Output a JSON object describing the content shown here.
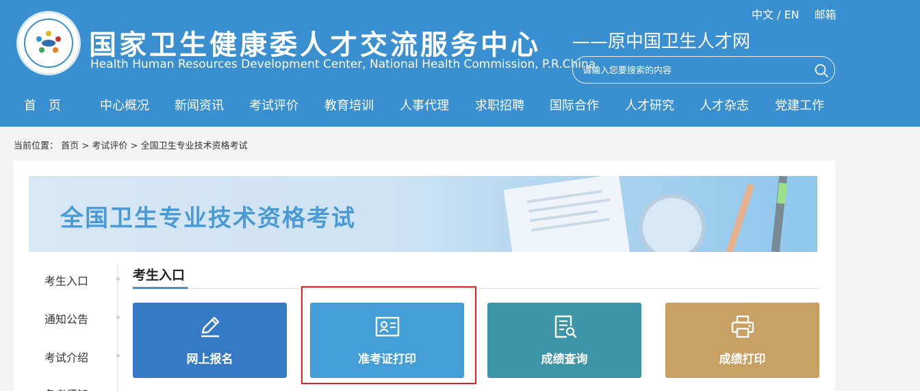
{
  "header": {
    "title": "国家卫生健康委人才交流服务中心",
    "subtitle": "Health Human Resources Development Center, National Health Commission, P.R.China",
    "alt_name": "——原中国卫生人才网",
    "lang_switch": "中文 / EN",
    "mail_link": "邮箱",
    "search_placeholder": "请输入您要搜索的内容"
  },
  "nav": [
    "首　页",
    "中心概况",
    "新闻资讯",
    "考试评价",
    "教育培训",
    "人事代理",
    "求职招聘",
    "国际合作",
    "人才研究",
    "人才杂志",
    "党建工作"
  ],
  "breadcrumb": {
    "prefix": "当前位置：",
    "items": [
      "首页",
      "考试评价",
      "全国卫生专业技术资格考试"
    ],
    "separator": ">"
  },
  "banner": {
    "title": "全国卫生专业技术资格考试"
  },
  "sidebar": [
    "考生入口",
    "通知公告",
    "考试介绍",
    "备考须知"
  ],
  "section": {
    "title": "考生入口"
  },
  "tiles": [
    {
      "label": "网上报名",
      "icon": "pencil-icon",
      "color": "#3679c4"
    },
    {
      "label": "准考证打印",
      "icon": "id-card-icon",
      "color": "#449fd8"
    },
    {
      "label": "成绩查询",
      "icon": "document-search-icon",
      "color": "#3e95a8"
    },
    {
      "label": "成绩打印",
      "icon": "printer-icon",
      "color": "#c9a064"
    }
  ],
  "colors": {
    "header_bg": "#3a8fd0",
    "highlight_box": "#d9201e"
  }
}
